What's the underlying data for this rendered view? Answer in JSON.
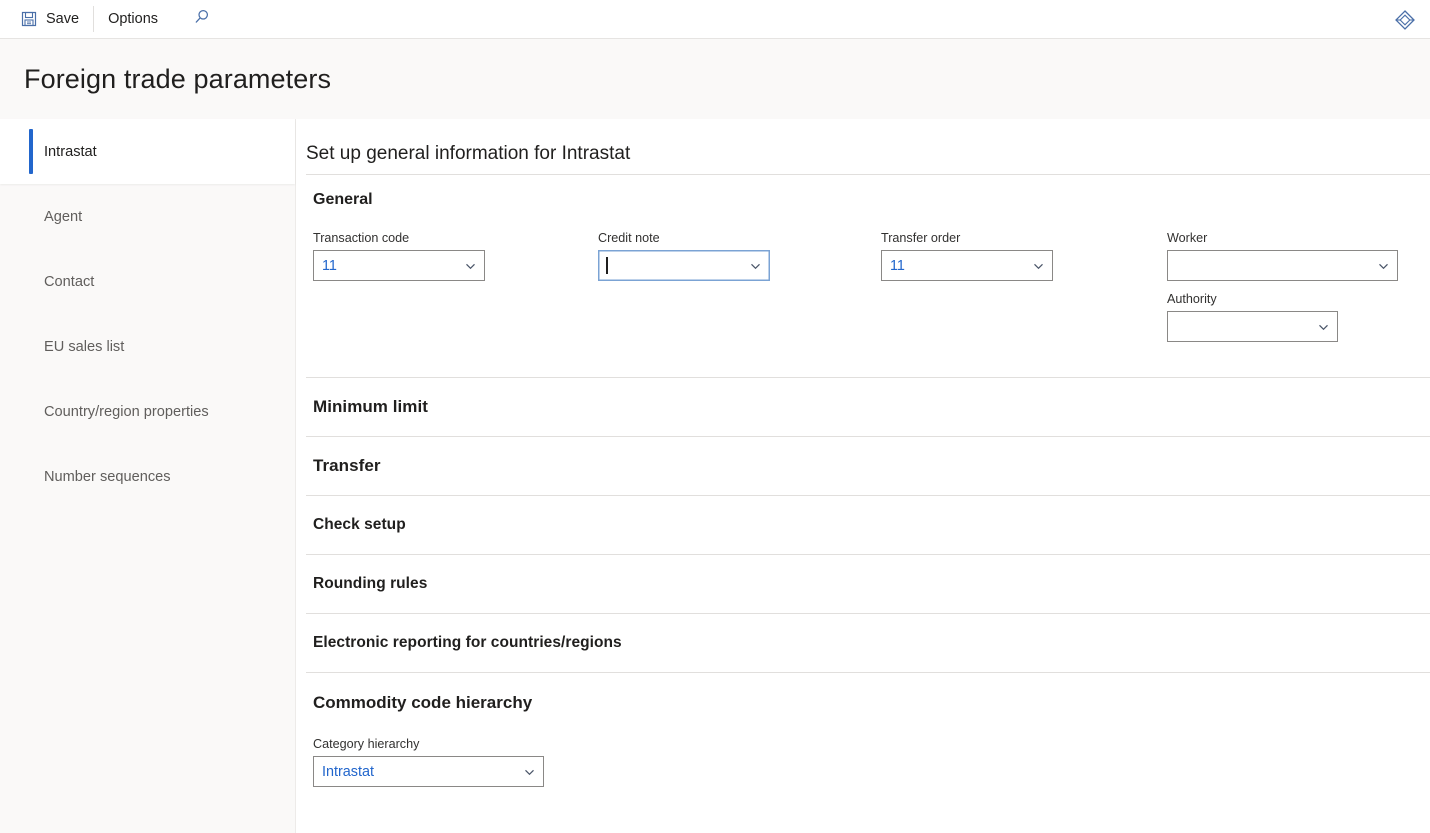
{
  "toolbar": {
    "save_label": "Save",
    "options_label": "Options",
    "search_icon": "search-icon",
    "save_icon": "save-floppy-icon",
    "right_icon": "diamond-badge-icon"
  },
  "header": {
    "title": "Foreign trade parameters"
  },
  "sidebar": {
    "items": [
      {
        "label": "Intrastat",
        "selected": true
      },
      {
        "label": "Agent",
        "selected": false
      },
      {
        "label": "Contact",
        "selected": false
      },
      {
        "label": "EU sales list",
        "selected": false
      },
      {
        "label": "Country/region properties",
        "selected": false
      },
      {
        "label": "Number sequences",
        "selected": false
      }
    ]
  },
  "main": {
    "heading": "Set up general information for Intrastat",
    "general": {
      "title": "General",
      "fields": [
        {
          "label": "Transaction code",
          "value": "11",
          "focused": false
        },
        {
          "label": "Credit note",
          "value": "",
          "focused": true
        },
        {
          "label": "Transfer order",
          "value": "11",
          "focused": false
        },
        {
          "label": "Worker",
          "value": "",
          "focused": false
        },
        {
          "label": "Authority",
          "value": "",
          "focused": false
        }
      ]
    },
    "collapsed_sections": [
      {
        "label": "Minimum limit"
      },
      {
        "label": "Transfer"
      },
      {
        "label": "Check setup"
      },
      {
        "label": "Rounding rules"
      },
      {
        "label": "Electronic reporting for countries/regions"
      }
    ],
    "commodity": {
      "title": "Commodity code hierarchy",
      "field": {
        "label": "Category hierarchy",
        "value": "Intrastat"
      }
    }
  },
  "colors": {
    "accent": "#2266cc",
    "value_text": "#2266cc",
    "border": "#8a8886",
    "focus_border": "#7ba3d4",
    "sidebar_bg": "#faf9f8",
    "divider": "#e1dfdd"
  }
}
